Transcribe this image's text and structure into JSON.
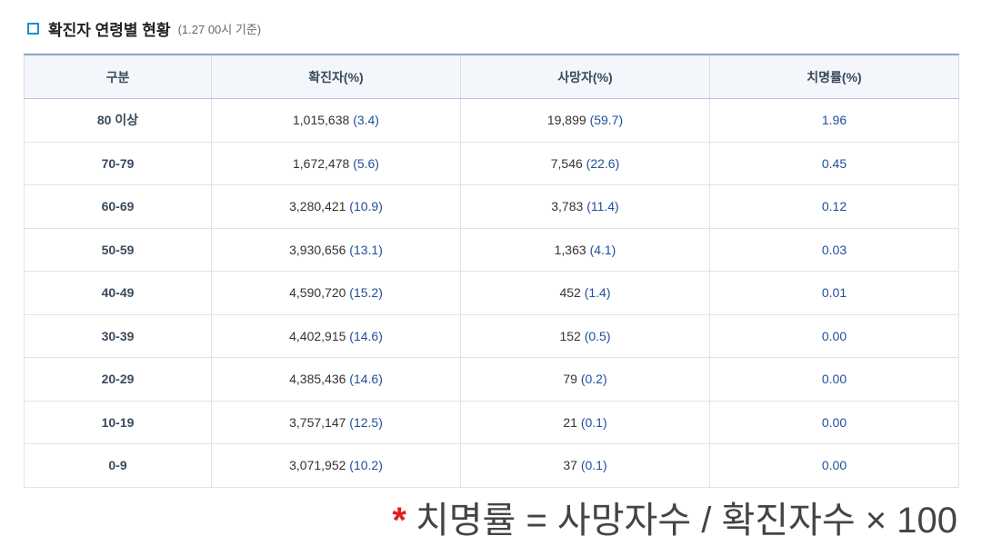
{
  "header": {
    "icon": "square-bullet-icon",
    "title": "확진자 연령별 현황",
    "basis": "(1.27 00시 기준)"
  },
  "table": {
    "columns": [
      "구분",
      "확진자(%)",
      "사망자(%)",
      "치명률(%)"
    ],
    "rows": [
      {
        "age": "80 이상",
        "cases": "1,015,638",
        "cases_pct": "(3.4)",
        "deaths": "19,899",
        "deaths_pct": "(59.7)",
        "rate": "1.96"
      },
      {
        "age": "70-79",
        "cases": "1,672,478",
        "cases_pct": "(5.6)",
        "deaths": "7,546",
        "deaths_pct": "(22.6)",
        "rate": "0.45"
      },
      {
        "age": "60-69",
        "cases": "3,280,421",
        "cases_pct": "(10.9)",
        "deaths": "3,783",
        "deaths_pct": "(11.4)",
        "rate": "0.12"
      },
      {
        "age": "50-59",
        "cases": "3,930,656",
        "cases_pct": "(13.1)",
        "deaths": "1,363",
        "deaths_pct": "(4.1)",
        "rate": "0.03"
      },
      {
        "age": "40-49",
        "cases": "4,590,720",
        "cases_pct": "(15.2)",
        "deaths": "452",
        "deaths_pct": "(1.4)",
        "rate": "0.01"
      },
      {
        "age": "30-39",
        "cases": "4,402,915",
        "cases_pct": "(14.6)",
        "deaths": "152",
        "deaths_pct": "(0.5)",
        "rate": "0.00"
      },
      {
        "age": "20-29",
        "cases": "4,385,436",
        "cases_pct": "(14.6)",
        "deaths": "79",
        "deaths_pct": "(0.2)",
        "rate": "0.00"
      },
      {
        "age": "10-19",
        "cases": "3,757,147",
        "cases_pct": "(12.5)",
        "deaths": "21",
        "deaths_pct": "(0.1)",
        "rate": "0.00"
      },
      {
        "age": "0-9",
        "cases": "3,071,952",
        "cases_pct": "(10.2)",
        "deaths": "37",
        "deaths_pct": "(0.1)",
        "rate": "0.00"
      }
    ]
  },
  "footnote": {
    "marker": "*",
    "text": "치명률 = 사망자수 / 확진자수 × 100"
  },
  "colors": {
    "accent": "#1a8fd0",
    "value_blue": "#1f4f9a",
    "marker_red": "#e02020"
  }
}
